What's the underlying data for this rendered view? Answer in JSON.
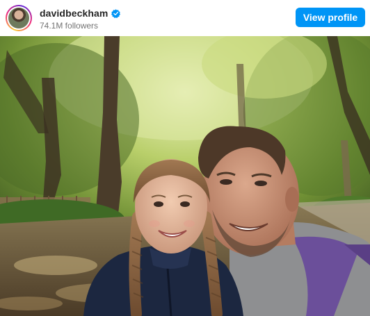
{
  "header": {
    "username": "davidbeckham",
    "followers_text": "74.1M followers",
    "view_profile_label": "View profile",
    "verified_icon": "verified-badge-icon"
  },
  "colors": {
    "accent": "#0095f6",
    "username_text": "#262626",
    "secondary_text": "#737373"
  }
}
